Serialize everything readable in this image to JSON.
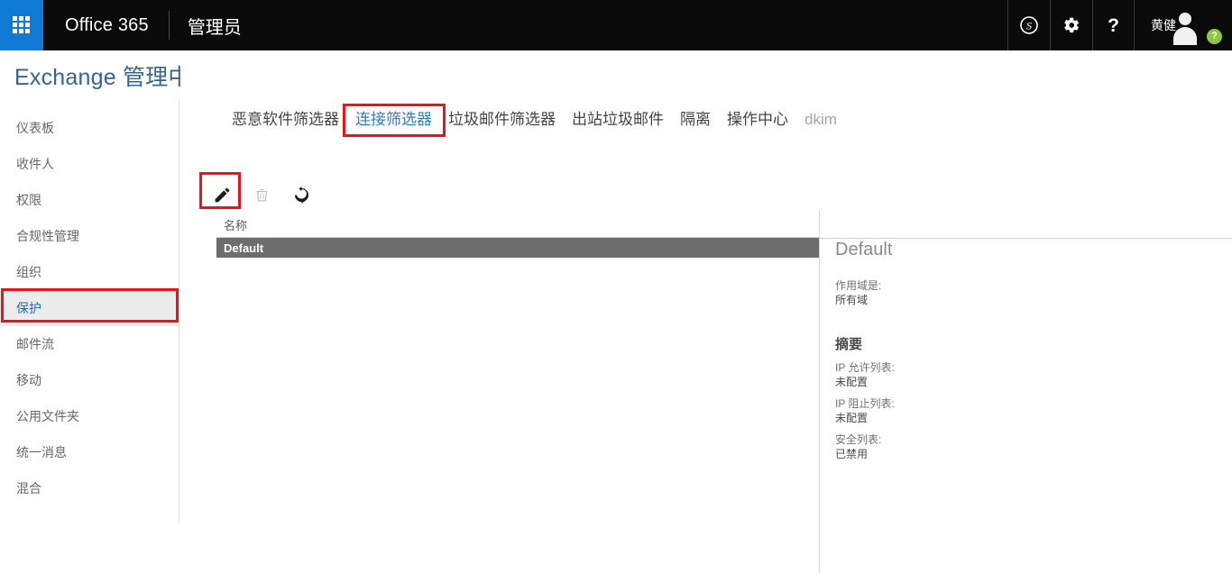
{
  "suite": {
    "waffle_icon": "app-launcher-waffle-icon",
    "brand": "Office 365",
    "app_name": "管理员",
    "icons": [
      {
        "name": "skype-icon",
        "glyph": "S"
      },
      {
        "name": "settings-gear-icon",
        "glyph": "gear"
      },
      {
        "name": "help-question-icon",
        "glyph": "?"
      }
    ],
    "user_name": "黄健",
    "avatar_badge": "?"
  },
  "page": {
    "title": "Exchange 管理中心"
  },
  "sidebar": {
    "items": [
      {
        "label": "仪表板",
        "selected": false
      },
      {
        "label": "收件人",
        "selected": false
      },
      {
        "label": "权限",
        "selected": false
      },
      {
        "label": "合规性管理",
        "selected": false
      },
      {
        "label": "组织",
        "selected": false
      },
      {
        "label": "保护",
        "selected": true
      },
      {
        "label": "邮件流",
        "selected": false
      },
      {
        "label": "移动",
        "selected": false
      },
      {
        "label": "公用文件夹",
        "selected": false
      },
      {
        "label": "统一消息",
        "selected": false
      },
      {
        "label": "混合",
        "selected": false
      }
    ]
  },
  "tabs": [
    {
      "label": "恶意软件筛选器",
      "state": "normal"
    },
    {
      "label": "连接筛选器",
      "state": "active"
    },
    {
      "label": "垃圾邮件筛选器",
      "state": "normal"
    },
    {
      "label": "出站垃圾邮件",
      "state": "normal"
    },
    {
      "label": "隔离",
      "state": "normal"
    },
    {
      "label": "操作中心",
      "state": "normal"
    },
    {
      "label": "dkim",
      "state": "muted"
    }
  ],
  "toolbar": {
    "buttons": [
      {
        "name": "edit-pencil-icon",
        "enabled": true,
        "title": "编辑"
      },
      {
        "name": "delete-trash-icon",
        "enabled": false,
        "title": "删除"
      },
      {
        "name": "refresh-icon",
        "enabled": true,
        "title": "刷新"
      }
    ]
  },
  "grid": {
    "columns": [
      "名称"
    ],
    "rows": [
      {
        "名称": "Default",
        "selected": true
      }
    ]
  },
  "details": {
    "title": "Default",
    "scope_label": "作用域是:",
    "scope_value": "所有域",
    "summary_heading": "摘要",
    "fields": [
      {
        "label": "IP 允许列表:",
        "value": "未配置"
      },
      {
        "label": "IP 阻止列表:",
        "value": "未配置"
      },
      {
        "label": "安全列表:",
        "value": "已禁用"
      }
    ]
  },
  "annotations": [
    {
      "name": "highlight-protection-nav",
      "color": "#e8141c"
    },
    {
      "name": "highlight-connection-filter-tab",
      "color": "#e8141c"
    },
    {
      "name": "highlight-edit-button",
      "color": "#e8141c"
    }
  ],
  "colors": {
    "waffle_blue": "#0f7ad4",
    "suite_bar": "#0a0a0a",
    "title_blue": "#37648f",
    "tab_active": "#2f7dbf",
    "row_selected": "#6d6d6d",
    "annotation_red": "#e8141c",
    "badge_green": "#8dc63f"
  }
}
